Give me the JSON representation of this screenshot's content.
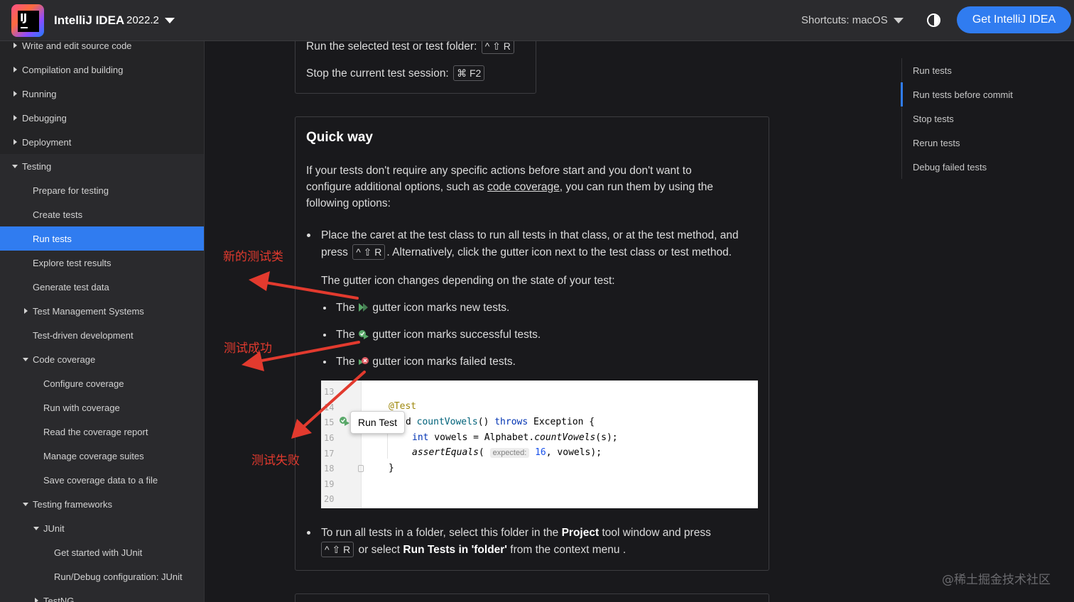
{
  "header": {
    "brand": "IntelliJ IDEA",
    "version": "2022.2",
    "shortcuts": "Shortcuts: macOS",
    "get_button": "Get IntelliJ IDEA",
    "accent_color": "#307cf0"
  },
  "sidebar": {
    "items": [
      {
        "label": "Write and edit source code"
      },
      {
        "label": "Compilation and building"
      },
      {
        "label": "Running"
      },
      {
        "label": "Debugging"
      },
      {
        "label": "Deployment"
      },
      {
        "label": "Testing"
      },
      {
        "label": "Prepare for testing"
      },
      {
        "label": "Create tests"
      },
      {
        "label": "Run tests"
      },
      {
        "label": "Explore test results"
      },
      {
        "label": "Generate test data"
      },
      {
        "label": "Test Management Systems"
      },
      {
        "label": "Test-driven development"
      },
      {
        "label": "Code coverage"
      },
      {
        "label": "Configure coverage"
      },
      {
        "label": "Run with coverage"
      },
      {
        "label": "Read the coverage report"
      },
      {
        "label": "Manage coverage suites"
      },
      {
        "label": "Save coverage data to a file"
      },
      {
        "label": "Testing frameworks"
      },
      {
        "label": "JUnit"
      },
      {
        "label": "Get started with JUnit"
      },
      {
        "label": "Run/Debug configuration: JUnit"
      },
      {
        "label": "TestNG"
      }
    ]
  },
  "shortcuts_card": {
    "run_selected": "Run the selected test or test folder:",
    "run_selected_keys": "^ ⇧ R",
    "stop_session": "Stop the current test session:",
    "stop_session_keys": "⌘ F2"
  },
  "quick_way": {
    "title": "Quick way",
    "intro_1": "If your tests don't require any specific actions before start and you don't want to",
    "intro_2a": "configure additional options, such as ",
    "intro_link": "code coverage",
    "intro_2b": ", you can run them by using the",
    "intro_3": "following options:",
    "bullet1_line1": "Place the caret at the test class to run all tests in that class, or at the test method, and",
    "bullet1_press": "press",
    "bullet1_keys": "^ ⇧ R",
    "bullet1_rest": ". Alternatively, click the gutter icon next to the test class or test method.",
    "gutter_intro": "The gutter icon changes depending on the state of your test:",
    "sub_the": "The",
    "sub1_rest": "gutter icon marks new tests.",
    "sub2_rest": "gutter icon marks successful tests.",
    "sub3_rest": "gutter icon marks failed tests.",
    "bullet2_line1a": "To run all tests in a folder, select this folder in the ",
    "bullet2_project": "Project",
    "bullet2_line1b": " tool window and press",
    "bullet2_keys": "^ ⇧ R",
    "bullet2_or": " or select ",
    "bullet2_menu": "Run Tests in 'folder'",
    "bullet2_end": " from the context menu ."
  },
  "code": {
    "line_numbers": [
      "13",
      "14",
      "15",
      "16",
      "17",
      "18",
      "19",
      "20"
    ],
    "annotation": "@Test",
    "line15_a": "d ",
    "line15_fn": "countVowels",
    "line15_b": "() ",
    "line15_kw": "throws",
    "line15_c": " Exception {",
    "line16_kw": "int",
    "line16_b": " vowels = Alphabet.",
    "line16_fn": "countVowels",
    "line16_c": "(s);",
    "line17_fn": "assertEquals",
    "line17_a": "( ",
    "line17_hint": "expected:",
    "line17_num": " 16",
    "line17_b": ", vowels);",
    "line18": "}",
    "tooltip": "Run Test"
  },
  "toc": {
    "items": [
      "Run tests",
      "Run tests before commit",
      "Stop tests",
      "Rerun tests",
      "Debug failed tests"
    ]
  },
  "annotations": {
    "new_test": "新的测试类",
    "success": "测试成功",
    "failed": "测试失败",
    "arrow_color": "#e23a2e"
  },
  "watermark": "@稀土掘金技术社区"
}
